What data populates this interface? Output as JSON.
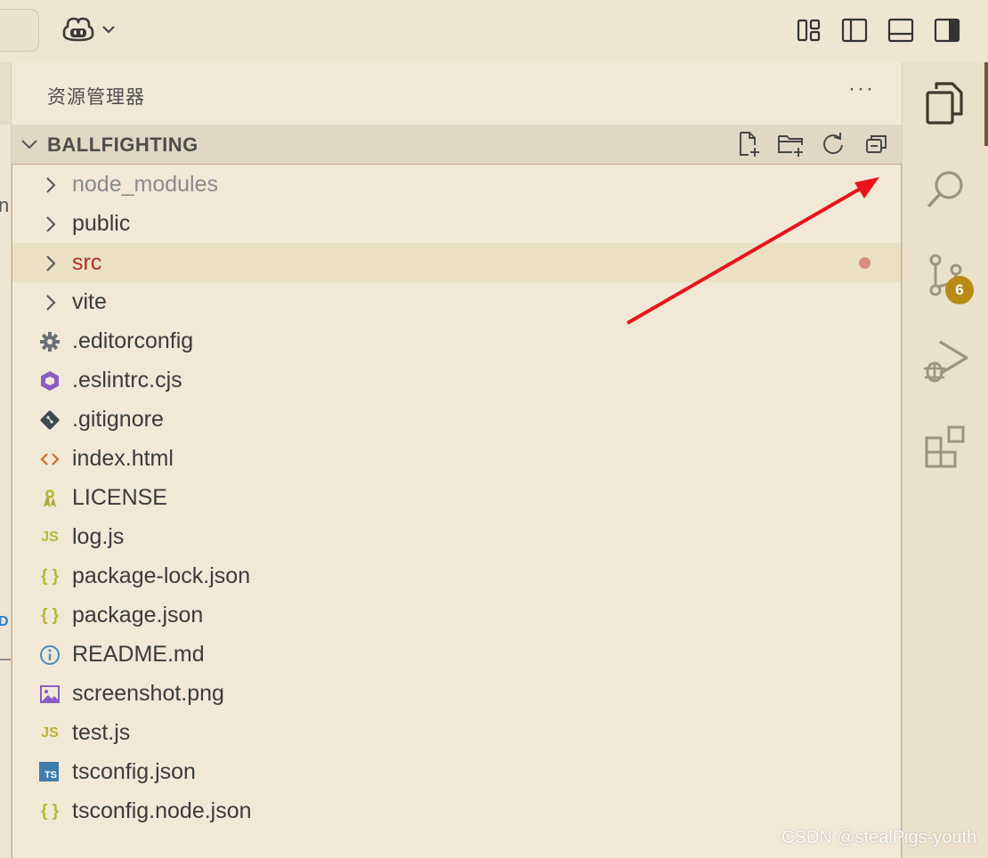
{
  "topbar": {
    "copilot_icon": "copilot-icon",
    "layout_buttons": [
      "customize-layout-icon",
      "toggle-primary-sidebar-icon",
      "toggle-panel-icon",
      "toggle-secondary-sidebar-icon"
    ]
  },
  "left_editor": {
    "partial_letter": "n",
    "partial_blue": "D"
  },
  "explorer": {
    "title": "资源管理器",
    "more_label": "···",
    "section_name": "BALLFIGHTING",
    "actions": [
      "new-file-icon",
      "new-folder-icon",
      "refresh-icon",
      "collapse-all-icon"
    ],
    "items": [
      {
        "label": "node_modules",
        "type": "folder"
      },
      {
        "label": "public",
        "type": "folder"
      },
      {
        "label": "src",
        "type": "folder"
      },
      {
        "label": "vite",
        "type": "folder"
      },
      {
        "label": ".editorconfig",
        "type": "file",
        "icon": "gear-icon"
      },
      {
        "label": ".eslintrc.cjs",
        "type": "file",
        "icon": "eslint-icon"
      },
      {
        "label": ".gitignore",
        "type": "file",
        "icon": "git-icon"
      },
      {
        "label": "index.html",
        "type": "file",
        "icon": "html-icon"
      },
      {
        "label": "LICENSE",
        "type": "file",
        "icon": "license-icon"
      },
      {
        "label": "log.js",
        "type": "file",
        "icon": "js-icon",
        "icon_text": "JS"
      },
      {
        "label": "package-lock.json",
        "type": "file",
        "icon": "json-icon",
        "icon_text": "{ }"
      },
      {
        "label": "package.json",
        "type": "file",
        "icon": "json-icon",
        "icon_text": "{ }"
      },
      {
        "label": "README.md",
        "type": "file",
        "icon": "info-icon"
      },
      {
        "label": "screenshot.png",
        "type": "file",
        "icon": "image-icon"
      },
      {
        "label": "test.js",
        "type": "file",
        "icon": "js-icon",
        "icon_text": "JS"
      },
      {
        "label": "tsconfig.json",
        "type": "file",
        "icon": "ts-icon",
        "icon_text": "TS"
      },
      {
        "label": "tsconfig.node.json",
        "type": "file",
        "icon": "json-icon",
        "icon_text": "{ }"
      }
    ]
  },
  "activity_bar": {
    "items": [
      "explorer-icon",
      "search-icon",
      "source-control-icon",
      "run-debug-icon",
      "extensions-icon"
    ],
    "source_control_badge": "6"
  },
  "colors": {
    "background": "#f1e9d6",
    "modified": "#b0312b",
    "badge": "#b88a16",
    "arrow": "#e8141c"
  },
  "watermark": "CSDN @stealPigs-youth"
}
